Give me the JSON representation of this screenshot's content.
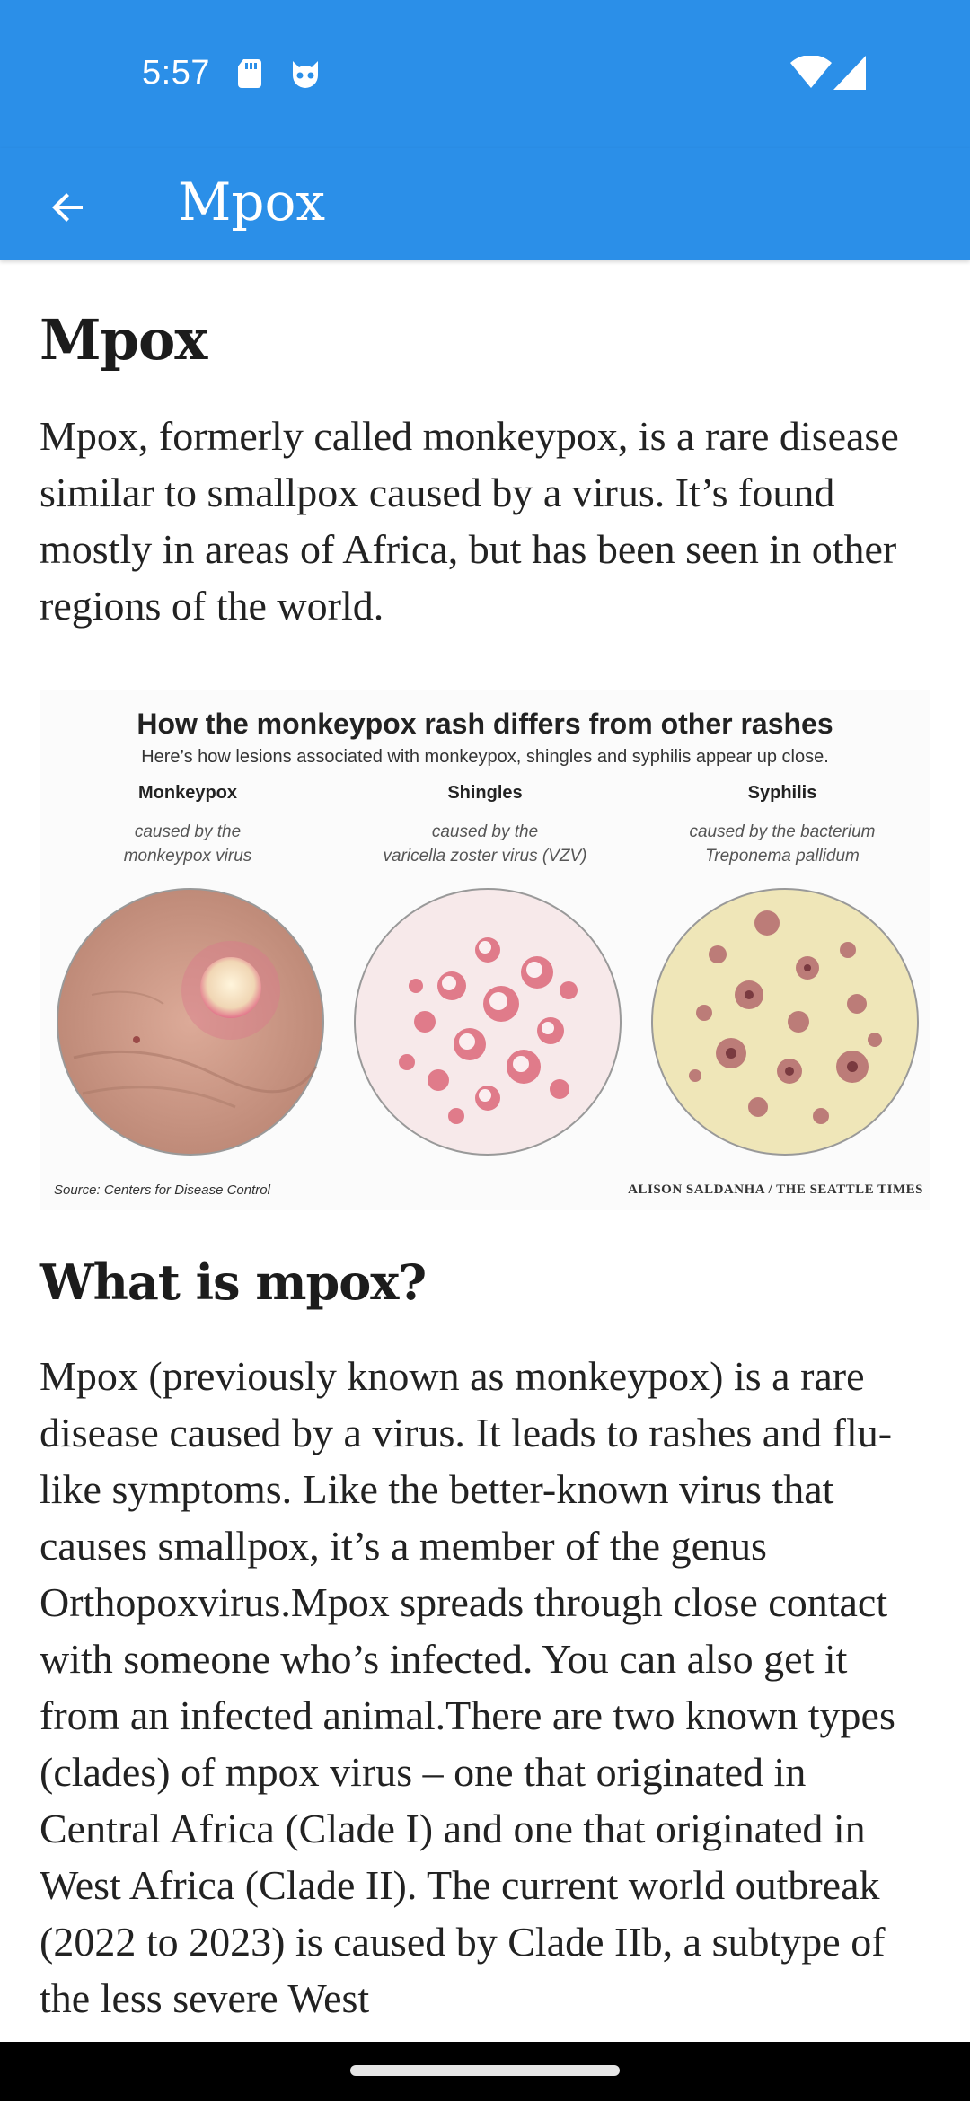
{
  "status_bar": {
    "time": "5:57",
    "icons": [
      "sd-card-icon",
      "cat-icon",
      "wifi-icon",
      "signal-icon"
    ]
  },
  "app_bar": {
    "back_icon": "arrow-back-icon",
    "title": "Mpox"
  },
  "article": {
    "heading": "Mpox",
    "intro": "Mpox, formerly called monkeypox, is a rare disease similar to smallpox caused by a virus. It’s found mostly in areas of Africa, but has been seen in other regions of the world.",
    "infographic": {
      "title": "How the monkeypox rash differs from other rashes",
      "subtitle": "Here’s how lesions associated with monkeypox, shingles and syphilis appear up close.",
      "columns": [
        {
          "name": "Monkeypox",
          "cause_line1": "caused by the",
          "cause_line2": "monkeypox virus"
        },
        {
          "name": "Shingles",
          "cause_line1": "caused by the",
          "cause_line2": "varicella zoster virus (VZV)"
        },
        {
          "name": "Syphilis",
          "cause_line1": "caused by the bacterium",
          "cause_line2": "Treponema pallidum"
        }
      ],
      "source": "Source: Centers for Disease Control",
      "credit": "ALISON SALDANHA / THE SEATTLE TIMES"
    },
    "section_heading": "What is mpox?",
    "section_body": "Mpox (previously known as monkeypox) is a rare disease caused by a virus. It leads to rashes and flu-like symptoms. Like the better-known virus that causes smallpox, it’s a member of the genus Orthopoxvirus.Mpox spreads through close contact with someone who’s infected. You can also get it from an infected animal.There are two known types (clades) of mpox virus – one that originated in Central Africa (Clade I) and one that originated in West Africa (Clade II). The current world outbreak (2022 to 2023) is caused by Clade IIb, a subtype of the less severe West"
  },
  "colors": {
    "primary": "#2b8fe8",
    "text": "#1c1c1c",
    "background": "#ffffff"
  }
}
